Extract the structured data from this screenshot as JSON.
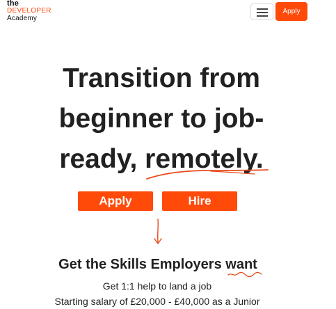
{
  "logo": {
    "the": "the",
    "developer": "DEVELOPER",
    "academy": "Academy"
  },
  "nav": {
    "menu_icon": "hamburger-menu-icon",
    "apply_label": "Apply"
  },
  "hero": {
    "line1": "Transition from",
    "line2": "beginner to job-",
    "line3": "ready, remotely."
  },
  "cta": {
    "apply_label": "Apply",
    "hire_label": "Hire"
  },
  "scroll_arrow_icon": "arrow-down-icon",
  "skills": {
    "heading": "Get the Skills Employers want",
    "line1": "Get 1:1 help to land a job",
    "line2": "Starting salary of £20,000 - £40,000 as a Junior"
  },
  "colors": {
    "accent": "#ff4a0a",
    "text": "#212121",
    "background": "#ffffff"
  }
}
